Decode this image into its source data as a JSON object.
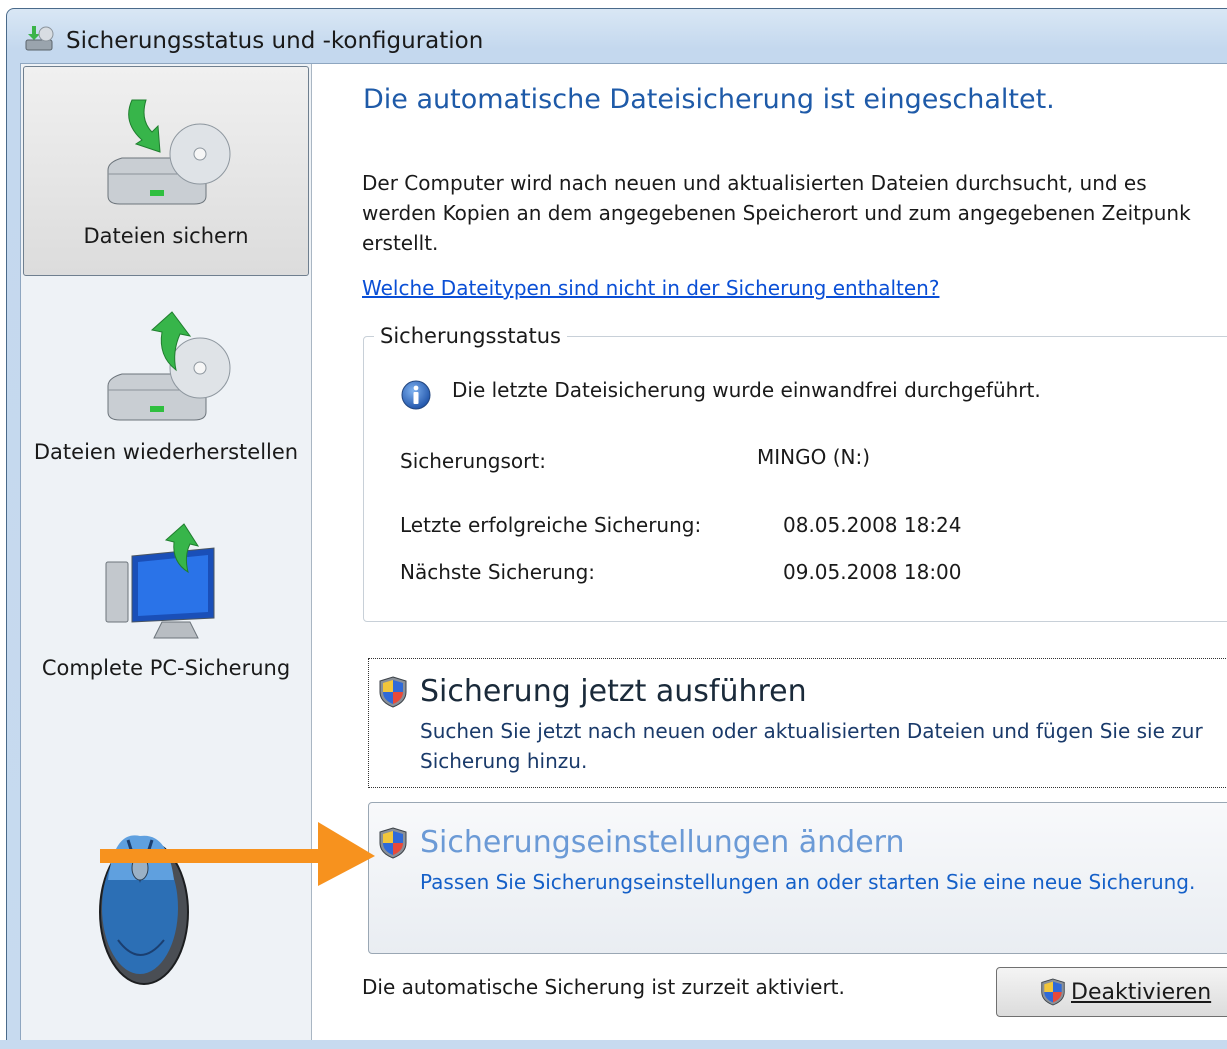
{
  "window": {
    "title": "Sicherungsstatus und -konfiguration",
    "title_icon": "backup-center-icon"
  },
  "sidebar": {
    "items": [
      {
        "label": "Dateien sichern",
        "icon": "backup-files-icon",
        "selected": true
      },
      {
        "label": "Dateien wiederherstellen",
        "icon": "restore-files-icon",
        "selected": false
      },
      {
        "label": "Complete PC-Sicherung",
        "icon": "complete-pc-backup-icon",
        "selected": false
      }
    ]
  },
  "main": {
    "headline": "Die automatische Dateisicherung ist eingeschaltet.",
    "description_lines": [
      "Der Computer wird nach neuen und aktualisierten Dateien durchsucht, und es",
      "werden Kopien an dem angegebenen Speicherort und zum angegebenen Zeitpunk",
      "erstellt."
    ],
    "help_link": "Welche Dateitypen sind nicht in der Sicherung enthalten?",
    "status_group": {
      "legend": "Sicherungsstatus",
      "info_message": "Die letzte Dateisicherung wurde einwandfrei durchgeführt.",
      "location_label": "Sicherungsort:",
      "location_value": "MINGO (N:)",
      "last_label": "Letzte erfolgreiche Sicherung:",
      "last_value": "08.05.2008 18:24",
      "next_label": "Nächste Sicherung:",
      "next_value": "09.05.2008 18:00"
    },
    "commands": [
      {
        "title": "Sicherung jetzt ausführen",
        "desc_lines": [
          "Suchen Sie jetzt nach neuen oder aktualisierten Dateien und fügen Sie sie zur",
          "Sicherung hinzu."
        ]
      },
      {
        "title": "Sicherungseinstellungen ändern",
        "desc_lines": [
          "Passen Sie Sicherungseinstellungen an oder starten Sie eine neue Sicherung."
        ]
      }
    ],
    "auto_status": "Die automatische Sicherung ist zurzeit aktiviert.",
    "deactivate_button": "Deaktivieren"
  },
  "colors": {
    "headline": "#1e5aa8",
    "link": "#0a4fd6",
    "hover_command_title": "#6b9ad6",
    "hover_command_desc": "#1560c8",
    "annotation_arrow": "#f7921e"
  }
}
